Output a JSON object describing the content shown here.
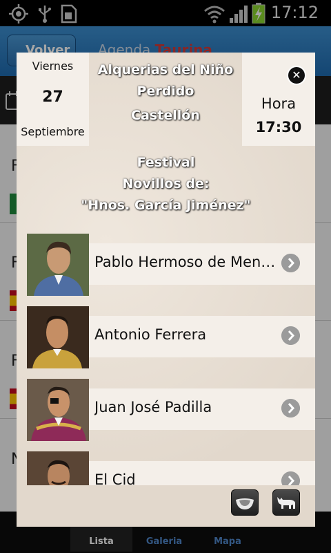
{
  "status_bar": {
    "time": "17:12",
    "icons": [
      "gps-icon",
      "usb-icon",
      "sd-card-icon",
      "wifi-icon",
      "signal-icon",
      "battery-charging-icon"
    ]
  },
  "app": {
    "back_label": "Volver",
    "title_part1": "Agenda",
    "title_part2": "Taurina",
    "list_letters": [
      "F",
      "F",
      "F",
      "N"
    ],
    "tabs": [
      {
        "label": "Lista",
        "active": true
      },
      {
        "label": "Galeria",
        "active": false
      },
      {
        "label": "Mapa",
        "active": false
      }
    ]
  },
  "event": {
    "date": {
      "weekday": "Viernes",
      "day": "27",
      "month": "Septiembre"
    },
    "venue_lines": [
      "Alquerias del Niño",
      "Perdido",
      "Castellón"
    ],
    "hour": {
      "label": "Hora",
      "value": "17:30"
    },
    "info_lines": [
      "Festival",
      "Novillos de:",
      "\"Hnos. García Jiménez\""
    ],
    "bullfighters": [
      {
        "name": "Pablo Hermoso de Mendoza",
        "icon": "chevron-right-icon"
      },
      {
        "name": "Antonio Ferrera",
        "icon": "chevron-right-icon"
      },
      {
        "name": "Juan José Padilla",
        "icon": "chevron-right-icon"
      },
      {
        "name": "El Cid",
        "icon": "chevron-right-icon"
      }
    ],
    "actions": [
      "bullring-icon",
      "bull-icon"
    ]
  },
  "colors": {
    "header_blue": "#2a76b8",
    "accent_red": "#d23b3b",
    "modal_bg": "#e6ddd2",
    "panel_bg": "#f4efe9"
  }
}
